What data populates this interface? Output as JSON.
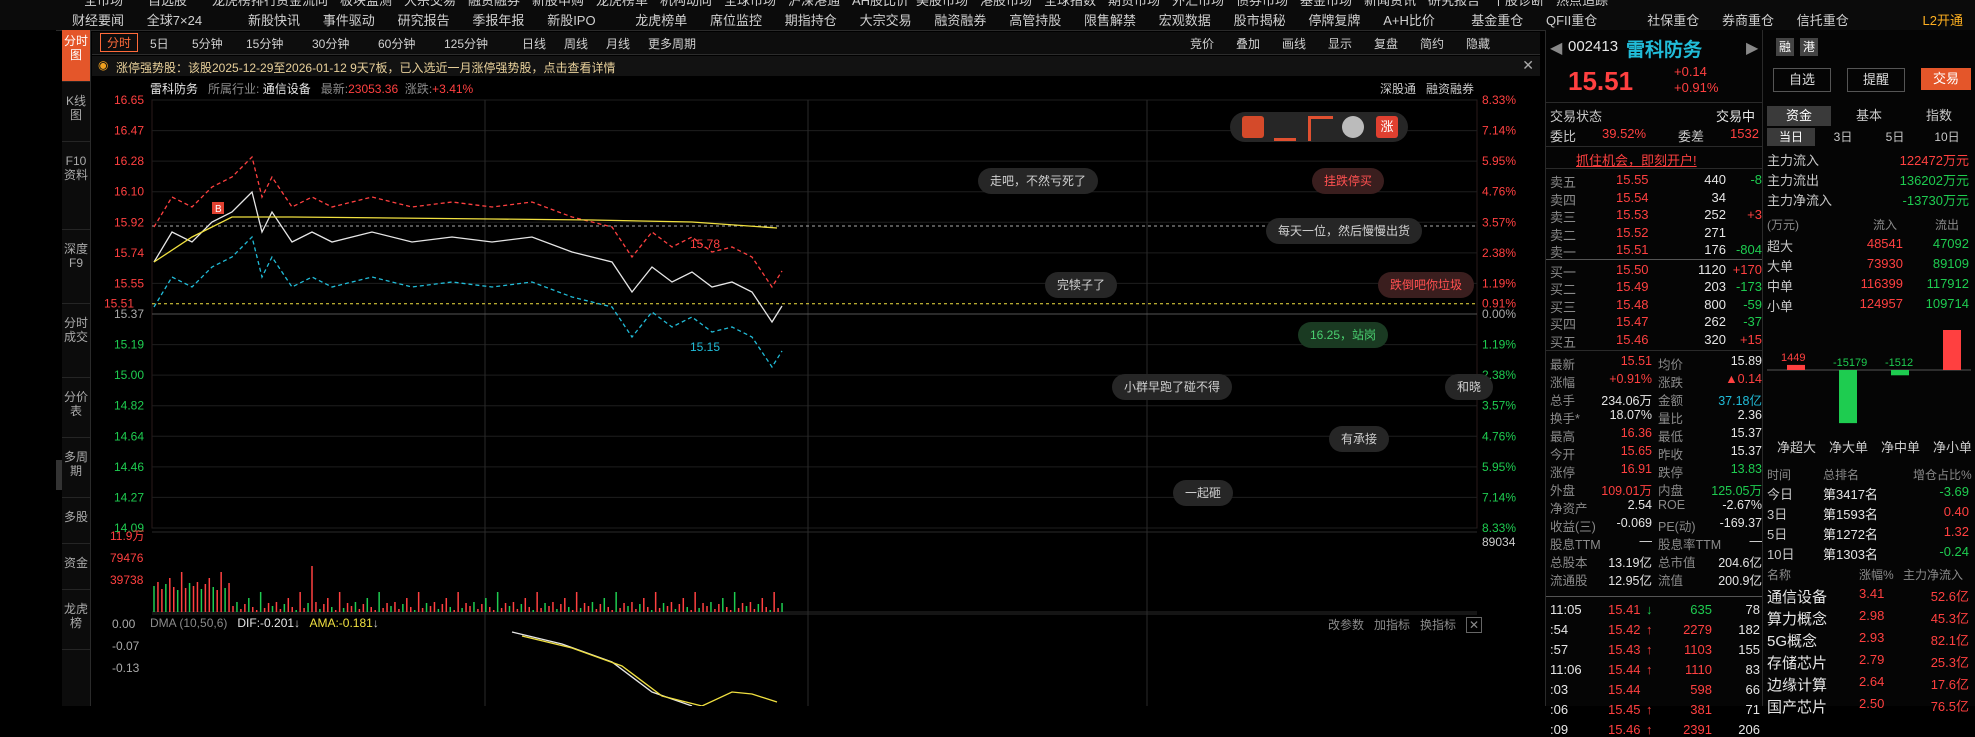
{
  "top_nav_row1": [
    "全市场",
    "自选股",
    "龙虎榜排行",
    "资金流向",
    "板块监测",
    "大宗交易",
    "融资融券",
    "新股申购",
    "龙虎榜单",
    "机构动向",
    "全球市场",
    "沪深港通",
    "AH股比价",
    "美股市场",
    "港股市场",
    "全球指数",
    "期货市场",
    "外汇市场",
    "债券市场",
    "基金市场",
    "新闻资讯",
    "研究报告",
    "个股诊断",
    "热点追踪"
  ],
  "top_nav": [
    "财经要闻",
    "全球7×24",
    "新股快讯",
    "事件驱动",
    "研究报告",
    "季报年报",
    "新股IPO",
    "龙虎榜单",
    "席位监控",
    "期指持仓",
    "大宗交易",
    "融资融券",
    "高管持股",
    "限售解禁",
    "宏观数据",
    "股市揭秘",
    "停牌复牌",
    "A+H比价",
    "基金重仓",
    "QFII重仓",
    "社保重仓",
    "券商重仓",
    "信托重仓"
  ],
  "top_right": "L2开通",
  "vtabs": [
    {
      "label": "分时图",
      "active": true
    },
    {
      "label": "K线图",
      "active": false
    },
    {
      "label": "F10资料",
      "active": false
    },
    {
      "label": "深度F9",
      "active": false
    },
    {
      "label": "分时成交",
      "active": false
    },
    {
      "label": "分价表",
      "active": false
    },
    {
      "label": "多周期",
      "active": false
    },
    {
      "label": "多股",
      "active": false
    },
    {
      "label": "资金",
      "active": false
    },
    {
      "label": "龙虎榜",
      "active": false
    }
  ],
  "chart_tabs": [
    "分时",
    "5日",
    "5分钟",
    "15分钟",
    "30分钟",
    "60分钟",
    "125分钟",
    "日线",
    "周线",
    "月线",
    "更多周期"
  ],
  "chart_tools": [
    "竞价",
    "叠加",
    "画线",
    "显示",
    "复盘",
    "简约",
    "隐藏"
  ],
  "banner": "涨停强势股：该股2025-12-29至2026-01-12 9天7板，已入选近一月涨停强势股，点击查看详情",
  "info": {
    "name": "雷科防务",
    "industry_label": "所属行业:",
    "industry": "通信设备",
    "latest_label": "最新:",
    "latest": "23053.36",
    "change_label": "涨跌:",
    "change": "+3.41%",
    "right1": "深股通",
    "right2": "融资融券"
  },
  "price_axis_left": [
    "16.65",
    "16.47",
    "16.28",
    "16.10",
    "15.92",
    "15.74",
    "15.55",
    "15.37",
    "15.19",
    "15.00",
    "14.82",
    "14.64",
    "14.46",
    "14.27",
    "14.09"
  ],
  "price_axis_right": [
    "8.33%",
    "7.14%",
    "5.95%",
    "4.76%",
    "3.57%",
    "2.38%",
    "1.19%",
    "0.00%",
    "1.19%",
    "2.38%",
    "3.57%",
    "4.76%",
    "5.95%",
    "7.14%",
    "8.33%"
  ],
  "current_price_tag": "15.51",
  "current_pct_tag": "0.91%",
  "upper_label": "15.78",
  "lower_label": "15.15",
  "vol_axis": [
    "11.9万",
    "79476",
    "39738"
  ],
  "vol_right": "89034",
  "ind_label": "DMA (10,50,6)",
  "ind_dif": "DIF:-0.201",
  "ind_ama": "AMA:-0.181",
  "ind_tools": [
    "改参数",
    "加指标",
    "换指标"
  ],
  "ind_axis": [
    "0.00",
    "-0.07",
    "-0.13"
  ],
  "bubbles": [
    {
      "text": "走吧，不然亏死了",
      "red": false
    },
    {
      "text": "挂跌停买",
      "red": true
    },
    {
      "text": "每天一位，然后慢慢出货",
      "red": false
    },
    {
      "text": "完犊子了",
      "red": false
    },
    {
      "text": "跌倒吧你垃圾",
      "red": true
    },
    {
      "text": "16.25，站岗",
      "red": false,
      "green": true
    },
    {
      "text": "小群早跑了碰不得",
      "red": false
    },
    {
      "text": "和晓",
      "red": false
    },
    {
      "text": "有承接",
      "red": false
    },
    {
      "text": "一起砸",
      "red": false
    }
  ],
  "stock": {
    "code": "002413",
    "name": "雷科防务",
    "price": "15.51",
    "change": "+0.14",
    "pct": "+0.91%",
    "tag1": "融",
    "tag2": "港"
  },
  "stock_buttons": [
    "自选",
    "提醒",
    "交易"
  ],
  "status_label": "交易状态",
  "status": "交易中",
  "webi_label": "委比",
  "webi": "39.52%",
  "weicha_label": "委差",
  "weicha": "1532",
  "promo": "抓住机会，即刻开户!",
  "asks": [
    {
      "label": "卖五",
      "price": "15.55",
      "vol": "440",
      "chg": "-8"
    },
    {
      "label": "卖四",
      "price": "15.54",
      "vol": "34",
      "chg": ""
    },
    {
      "label": "卖三",
      "price": "15.53",
      "vol": "252",
      "chg": "+3"
    },
    {
      "label": "卖二",
      "price": "15.52",
      "vol": "271",
      "chg": ""
    },
    {
      "label": "卖一",
      "price": "15.51",
      "vol": "176",
      "chg": "-804"
    }
  ],
  "bids": [
    {
      "label": "买一",
      "price": "15.50",
      "vol": "1120",
      "chg": "+170"
    },
    {
      "label": "买二",
      "price": "15.49",
      "vol": "203",
      "chg": "-173"
    },
    {
      "label": "买三",
      "price": "15.48",
      "vol": "800",
      "chg": "-59"
    },
    {
      "label": "买四",
      "price": "15.47",
      "vol": "262",
      "chg": "-37"
    },
    {
      "label": "买五",
      "price": "15.46",
      "vol": "320",
      "chg": "+15"
    }
  ],
  "stats": [
    [
      "最新",
      "15.51",
      "均价",
      "15.89"
    ],
    [
      "涨幅",
      "+0.91%",
      "涨跌",
      "▲0.14"
    ],
    [
      "总手",
      "234.06万",
      "金额",
      "37.18亿"
    ],
    [
      "换手*",
      "18.07%",
      "量比",
      "2.36"
    ],
    [
      "最高",
      "16.36",
      "最低",
      "15.37"
    ],
    [
      "今开",
      "15.65",
      "昨收",
      "15.37"
    ],
    [
      "涨停",
      "16.91",
      "跌停",
      "13.83"
    ],
    [
      "外盘",
      "109.01万",
      "内盘",
      "125.05万"
    ],
    [
      "净资产",
      "2.54",
      "ROE",
      "-2.67%"
    ],
    [
      "收益(三)",
      "-0.069",
      "PE(动)",
      "-169.37"
    ],
    [
      "股息TTM",
      "—",
      "股息率TTM",
      "—"
    ],
    [
      "总股本",
      "13.19亿",
      "总市值",
      "204.6亿"
    ],
    [
      "流通股",
      "12.95亿",
      "流值",
      "200.9亿"
    ]
  ],
  "ticks": [
    {
      "time": "11:05",
      "price": "15.41",
      "arrow": "↓",
      "vol": "635",
      "n": "78"
    },
    {
      "time": ":54",
      "price": "15.42",
      "arrow": "↑",
      "vol": "2279",
      "n": "182"
    },
    {
      "time": ":57",
      "price": "15.43",
      "arrow": "↑",
      "vol": "1103",
      "n": "155"
    },
    {
      "time": "11:06",
      "price": "15.44",
      "arrow": "↑",
      "vol": "1110",
      "n": "83"
    },
    {
      "time": ":03",
      "price": "15.44",
      "arrow": "",
      "vol": "598",
      "n": "66"
    },
    {
      "time": ":06",
      "price": "15.45",
      "arrow": "↑",
      "vol": "381",
      "n": "71"
    },
    {
      "time": ":09",
      "price": "15.46",
      "arrow": "↑",
      "vol": "2391",
      "n": "206"
    }
  ],
  "fund_tabs": [
    "资金",
    "基本",
    "指数"
  ],
  "period_tabs": [
    "当日",
    "3日",
    "5日",
    "10日"
  ],
  "fund_rows": [
    [
      "主力流入",
      "122472万元"
    ],
    [
      "主力流出",
      "136202万元"
    ],
    [
      "主力净流入",
      "-13730万元"
    ]
  ],
  "flow_header": [
    "(万元)",
    "流入",
    "流出"
  ],
  "flow_rows": [
    [
      "超大",
      "48541",
      "47092"
    ],
    [
      "大单",
      "73930",
      "89109"
    ],
    [
      "中单",
      "116399",
      "117912"
    ],
    [
      "小单",
      "124957",
      "109714"
    ]
  ],
  "net_flow": {
    "categories": [
      "净超大",
      "净大单",
      "净中单",
      "净小单"
    ],
    "values": [
      1449,
      -15179,
      -1512,
      15243
    ]
  },
  "rank_header": [
    "时间",
    "总排名",
    "增仓占比%"
  ],
  "rank_rows": [
    [
      "今日",
      "第3417名",
      "-3.69"
    ],
    [
      "3日",
      "第1593名",
      "0.40"
    ],
    [
      "5日",
      "第1272名",
      "1.32"
    ],
    [
      "10日",
      "第1303名",
      "-0.24"
    ]
  ],
  "sector_header": [
    "名称",
    "涨幅%",
    "主力净流入"
  ],
  "sectors": [
    [
      "通信设备",
      "3.41",
      "52.6亿"
    ],
    [
      "算力概念",
      "2.98",
      "45.3亿"
    ],
    [
      "5G概念",
      "2.93",
      "82.1亿"
    ],
    [
      "存储芯片",
      "2.79",
      "25.3亿"
    ],
    [
      "边缘计算",
      "2.64",
      "17.6亿"
    ],
    [
      "国产芯片",
      "2.50",
      "76.5亿"
    ]
  ],
  "colors": {
    "up": "#ff4040",
    "down": "#1ecc50",
    "accent": "#e4562a"
  }
}
